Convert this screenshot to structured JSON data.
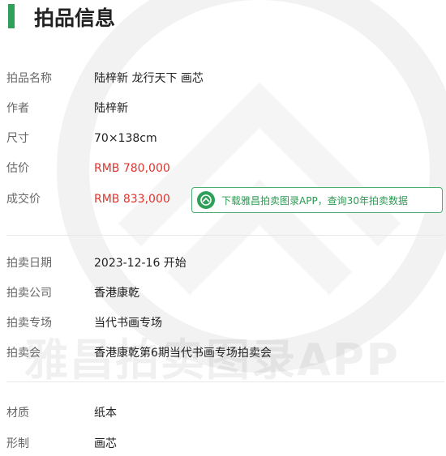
{
  "header": {
    "title": "拍品信息"
  },
  "colors": {
    "accent": "#2fa05a",
    "price": "#e0332b",
    "label": "#666666"
  },
  "details": [
    {
      "label": "拍品名称",
      "value": "陆梓新 龙行天下 画芯"
    },
    {
      "label": "作者",
      "value": "陆梓新"
    },
    {
      "label": "尺寸",
      "value": "70×138cm"
    },
    {
      "label": "估价",
      "value": "RMB 780,000"
    },
    {
      "label": "成交价",
      "value": "RMB 833,000"
    }
  ],
  "app_button": {
    "label": "下载雅昌拍卖图录APP，查询30年拍卖数据",
    "icon": "yachang-logo-icon"
  },
  "auction": [
    {
      "label": "拍卖日期",
      "value": "2023-12-16 开始"
    },
    {
      "label": "拍卖公司",
      "value": "香港康乾"
    },
    {
      "label": "拍卖专场",
      "value": "当代书画专场"
    },
    {
      "label": "拍卖会",
      "value": "香港康乾第6期当代书画专场拍卖会"
    }
  ],
  "physical": [
    {
      "label": "材质",
      "value": "纸本"
    },
    {
      "label": "形制",
      "value": "画芯"
    }
  ],
  "watermark": {
    "text": "雅昌拍卖图录APP"
  }
}
